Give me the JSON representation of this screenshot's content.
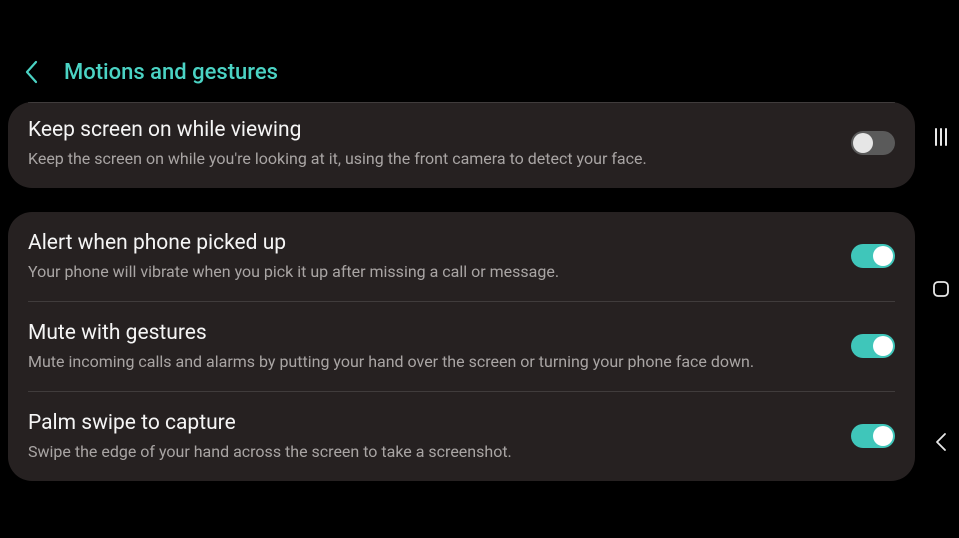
{
  "header": {
    "title": "Motions and gestures"
  },
  "accent_color": "#4bd3c4",
  "groups": [
    {
      "items": [
        {
          "key": "keep_screen_on",
          "title": "Keep screen on while viewing",
          "desc": "Keep the screen on while you're looking at it, using the front camera to detect your face.",
          "enabled": false
        }
      ]
    },
    {
      "items": [
        {
          "key": "alert_pickup",
          "title": "Alert when phone picked up",
          "desc": "Your phone will vibrate when you pick it up after missing a call or message.",
          "enabled": true
        },
        {
          "key": "mute_gestures",
          "title": "Mute with gestures",
          "desc": "Mute incoming calls and alarms by putting your hand over the screen or turning your phone face down.",
          "enabled": true
        },
        {
          "key": "palm_swipe",
          "title": "Palm swipe to capture",
          "desc": "Swipe the edge of your hand across the screen to take a screenshot.",
          "enabled": true
        }
      ]
    }
  ]
}
